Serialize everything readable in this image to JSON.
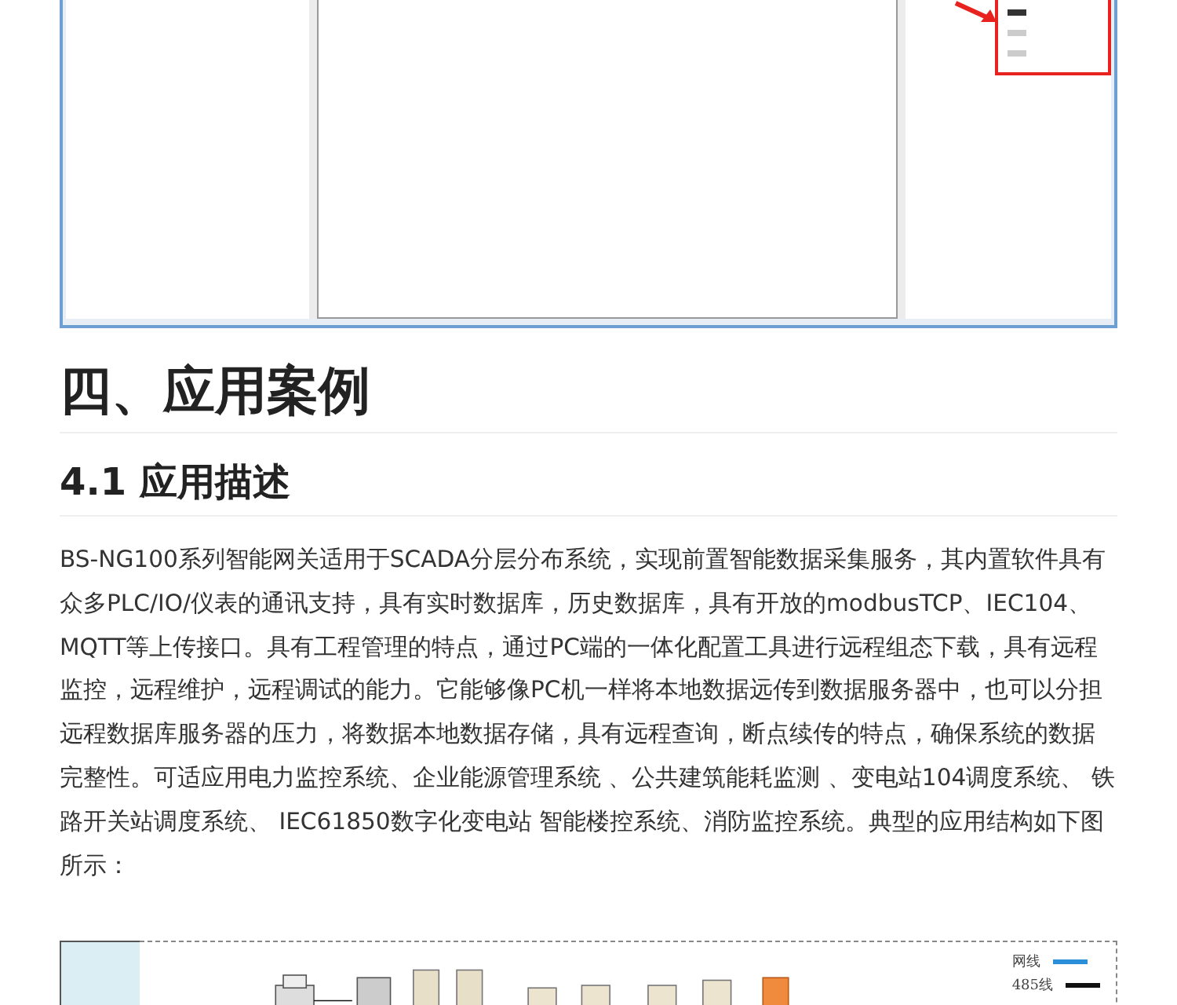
{
  "heading": "四、应用案例",
  "subheading": "4.1 应用描述",
  "paragraph": "BS-NG100系列智能网关适用于SCADA分层分布系统，实现前置智能数据采集服务，其内置软件具有众多PLC/IO/仪表的通讯支持，具有实时数据库，历史数据库，具有开放的modbusTCP、IEC104、MQTT等上传接口。具有工程管理的特点，通过PC端的一体化配置工具进行远程组态下载，具有远程监控，远程维护，远程调试的能力。它能够像PC机一样将本地数据远传到数据服务器中，也可以分担远程数据库服务器的压力，将数据本地数据存储，具有远程查询，断点续传的特点，确保系统的数据完整性。可适应用电力监控系统、企业能源管理系统 、公共建筑能耗监测 、变电站104调度系统、 铁路开关站调度系统、 IEC61850数字化变电站 智能楼控系统、消防监控系统。典型的应用结构如下图所示：",
  "diagram": {
    "legend": [
      {
        "label": "网线",
        "color": "#2a8fd8"
      },
      {
        "label": "485线",
        "color": "#111111"
      }
    ]
  }
}
